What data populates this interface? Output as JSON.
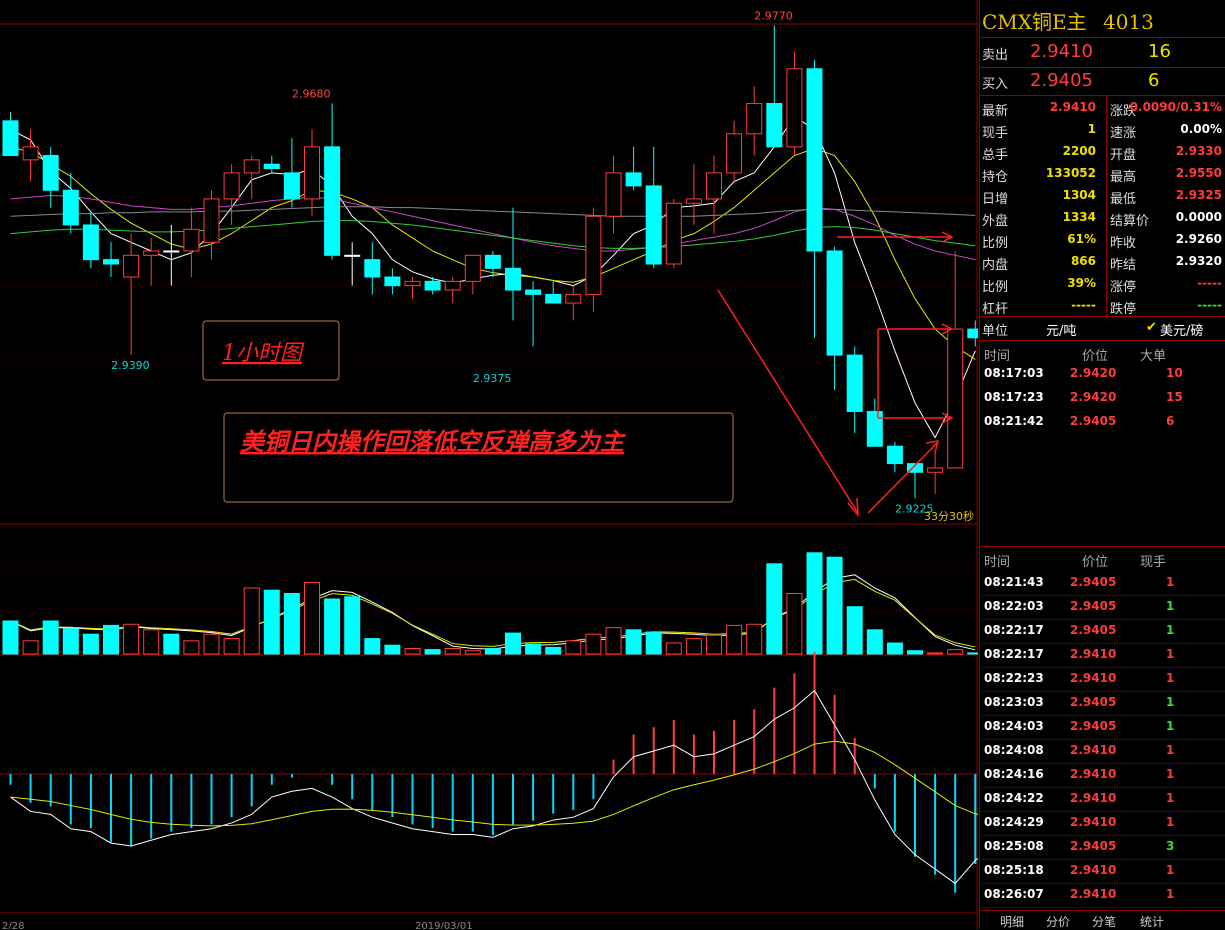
{
  "instrument": {
    "name": "CMX铜E主",
    "code": "4013"
  },
  "quote": {
    "sell_label": "卖出",
    "sell_price": "2.9410",
    "sell_vol": "16",
    "buy_label": "买入",
    "buy_price": "2.9405",
    "buy_vol": "6"
  },
  "stats": [
    {
      "l1": "最新",
      "v1": "2.9410",
      "c1": "red",
      "l2": "涨跌",
      "v2": "0.0090/0.31%",
      "c2": "red"
    },
    {
      "l1": "现手",
      "v1": "1",
      "c1": "yellow",
      "l2": "速涨",
      "v2": "0.00%",
      "c2": "white"
    },
    {
      "l1": "总手",
      "v1": "2200",
      "c1": "yellow",
      "l2": "开盘",
      "v2": "2.9330",
      "c2": "red"
    },
    {
      "l1": "持仓",
      "v1": "133052",
      "c1": "yellow",
      "l2": "最高",
      "v2": "2.9550",
      "c2": "red"
    },
    {
      "l1": "日增",
      "v1": "1304",
      "c1": "yellow",
      "l2": "最低",
      "v2": "2.9325",
      "c2": "red"
    },
    {
      "l1": "外盘",
      "v1": "1334",
      "c1": "yellow",
      "l2": "结算价",
      "v2": "0.0000",
      "c2": "white"
    },
    {
      "l1": "比例",
      "v1": "61%",
      "c1": "yellow",
      "l2": "昨收",
      "v2": "2.9260",
      "c2": "white"
    },
    {
      "l1": "内盘",
      "v1": "866",
      "c1": "yellow",
      "l2": "昨结",
      "v2": "2.9320",
      "c2": "white"
    },
    {
      "l1": "比例",
      "v1": "39%",
      "c1": "yellow",
      "l2": "涨停",
      "v2": "-----",
      "c2": "red"
    },
    {
      "l1": "杠杆",
      "v1": "-----",
      "c1": "yellow",
      "l2": "跌停",
      "v2": "-----",
      "c2": "green"
    }
  ],
  "unit": {
    "label": "单位",
    "value": "元/吨",
    "alt": "美元/磅"
  },
  "big_orders": {
    "headers": [
      "时间",
      "价位",
      "大单"
    ],
    "rows": [
      {
        "time": "08:17:03",
        "price": "2.9420",
        "vol": "10"
      },
      {
        "time": "08:17:23",
        "price": "2.9420",
        "vol": "15"
      },
      {
        "time": "08:21:42",
        "price": "2.9405",
        "vol": "6"
      }
    ]
  },
  "ticks": {
    "headers": [
      "时间",
      "价位",
      "现手"
    ],
    "rows": [
      {
        "time": "08:21:43",
        "price": "2.9405",
        "vol": "1",
        "vc": "red"
      },
      {
        "time": "08:22:03",
        "price": "2.9405",
        "vol": "1",
        "vc": "green"
      },
      {
        "time": "08:22:17",
        "price": "2.9405",
        "vol": "1",
        "vc": "green"
      },
      {
        "time": "08:22:17",
        "price": "2.9410",
        "vol": "1",
        "vc": "red"
      },
      {
        "time": "08:22:23",
        "price": "2.9410",
        "vol": "1",
        "vc": "red"
      },
      {
        "time": "08:23:03",
        "price": "2.9405",
        "vol": "1",
        "vc": "green"
      },
      {
        "time": "08:24:03",
        "price": "2.9405",
        "vol": "1",
        "vc": "green"
      },
      {
        "time": "08:24:08",
        "price": "2.9410",
        "vol": "1",
        "vc": "red"
      },
      {
        "time": "08:24:16",
        "price": "2.9410",
        "vol": "1",
        "vc": "red"
      },
      {
        "time": "08:24:22",
        "price": "2.9410",
        "vol": "1",
        "vc": "red"
      },
      {
        "time": "08:24:29",
        "price": "2.9410",
        "vol": "1",
        "vc": "red"
      },
      {
        "time": "08:25:08",
        "price": "2.9405",
        "vol": "3",
        "vc": "green"
      },
      {
        "time": "08:25:18",
        "price": "2.9410",
        "vol": "1",
        "vc": "red"
      },
      {
        "time": "08:26:07",
        "price": "2.9410",
        "vol": "1",
        "vc": "red"
      }
    ]
  },
  "tabs": [
    "明细",
    "分价",
    "分笔",
    "统计"
  ],
  "chart_data": {
    "type": "candlestick",
    "price_range": [
      2.92,
      2.979
    ],
    "price_labels": [
      {
        "text": "2.9770",
        "value": 2.977,
        "color": "#ff4444"
      },
      {
        "text": "2.9680",
        "value": 2.968,
        "color": "#ff4444"
      },
      {
        "text": "2.9390",
        "value": 2.939,
        "color": "#00d8d8"
      },
      {
        "text": "2.9375",
        "value": 2.9375,
        "color": "#00d8d8"
      },
      {
        "text": "2.9225",
        "value": 2.9225,
        "color": "#00d8d8"
      }
    ],
    "date_labels": [
      "2/28",
      "2019/03/01"
    ],
    "countdown": "33分30秒",
    "annotations": [
      "1小时图",
      "美铜日内操作回落低空反弹高多为主"
    ],
    "candles": [
      {
        "o": 2.966,
        "h": 2.967,
        "l": 2.962,
        "c": 2.962,
        "v": 30
      },
      {
        "o": 2.9615,
        "h": 2.965,
        "l": 2.959,
        "c": 2.963,
        "v": 12
      },
      {
        "o": 2.962,
        "h": 2.963,
        "l": 2.956,
        "c": 2.958,
        "v": 30
      },
      {
        "o": 2.958,
        "h": 2.96,
        "l": 2.953,
        "c": 2.954,
        "v": 23
      },
      {
        "o": 2.954,
        "h": 2.9555,
        "l": 2.949,
        "c": 2.95,
        "v": 18
      },
      {
        "o": 2.95,
        "h": 2.952,
        "l": 2.948,
        "c": 2.9495,
        "v": 26
      },
      {
        "o": 2.948,
        "h": 2.953,
        "l": 2.939,
        "c": 2.9505,
        "v": 27
      },
      {
        "o": 2.9505,
        "h": 2.9525,
        "l": 2.947,
        "c": 2.951,
        "v": 22
      },
      {
        "o": 2.951,
        "h": 2.954,
        "l": 2.947,
        "c": 2.951,
        "v": 18
      },
      {
        "o": 2.951,
        "h": 2.956,
        "l": 2.948,
        "c": 2.9535,
        "v": 12
      },
      {
        "o": 2.952,
        "h": 2.958,
        "l": 2.95,
        "c": 2.957,
        "v": 18
      },
      {
        "o": 2.957,
        "h": 2.961,
        "l": 2.954,
        "c": 2.96,
        "v": 14
      },
      {
        "o": 2.96,
        "h": 2.962,
        "l": 2.957,
        "c": 2.9615,
        "v": 60
      },
      {
        "o": 2.961,
        "h": 2.962,
        "l": 2.96,
        "c": 2.9605,
        "v": 58
      },
      {
        "o": 2.96,
        "h": 2.964,
        "l": 2.956,
        "c": 2.957,
        "v": 55
      },
      {
        "o": 2.957,
        "h": 2.965,
        "l": 2.955,
        "c": 2.963,
        "v": 65
      },
      {
        "o": 2.963,
        "h": 2.968,
        "l": 2.95,
        "c": 2.9505,
        "v": 50
      },
      {
        "o": 2.9505,
        "h": 2.952,
        "l": 2.947,
        "c": 2.9505,
        "v": 52
      },
      {
        "o": 2.95,
        "h": 2.952,
        "l": 2.946,
        "c": 2.948,
        "v": 14
      },
      {
        "o": 2.948,
        "h": 2.949,
        "l": 2.946,
        "c": 2.947,
        "v": 8
      },
      {
        "o": 2.947,
        "h": 2.948,
        "l": 2.9455,
        "c": 2.9475,
        "v": 5
      },
      {
        "o": 2.9475,
        "h": 2.948,
        "l": 2.946,
        "c": 2.9465,
        "v": 4
      },
      {
        "o": 2.9465,
        "h": 2.948,
        "l": 2.945,
        "c": 2.9475,
        "v": 5
      },
      {
        "o": 2.9475,
        "h": 2.9505,
        "l": 2.946,
        "c": 2.9505,
        "v": 3
      },
      {
        "o": 2.9505,
        "h": 2.951,
        "l": 2.948,
        "c": 2.949,
        "v": 5
      },
      {
        "o": 2.949,
        "h": 2.956,
        "l": 2.943,
        "c": 2.9465,
        "v": 19
      },
      {
        "o": 2.9465,
        "h": 2.9475,
        "l": 2.94,
        "c": 2.946,
        "v": 9
      },
      {
        "o": 2.946,
        "h": 2.9475,
        "l": 2.945,
        "c": 2.945,
        "v": 6
      },
      {
        "o": 2.945,
        "h": 2.947,
        "l": 2.943,
        "c": 2.946,
        "v": 12
      },
      {
        "o": 2.946,
        "h": 2.956,
        "l": 2.944,
        "c": 2.955,
        "v": 18
      },
      {
        "o": 2.955,
        "h": 2.962,
        "l": 2.953,
        "c": 2.96,
        "v": 24
      },
      {
        "o": 2.96,
        "h": 2.963,
        "l": 2.958,
        "c": 2.9585,
        "v": 22
      },
      {
        "o": 2.9585,
        "h": 2.963,
        "l": 2.949,
        "c": 2.9495,
        "v": 20
      },
      {
        "o": 2.9495,
        "h": 2.957,
        "l": 2.949,
        "c": 2.9565,
        "v": 10
      },
      {
        "o": 2.9565,
        "h": 2.961,
        "l": 2.954,
        "c": 2.957,
        "v": 14
      },
      {
        "o": 2.957,
        "h": 2.962,
        "l": 2.953,
        "c": 2.96,
        "v": 17
      },
      {
        "o": 2.96,
        "h": 2.966,
        "l": 2.959,
        "c": 2.9645,
        "v": 26
      },
      {
        "o": 2.9645,
        "h": 2.97,
        "l": 2.962,
        "c": 2.968,
        "v": 27
      },
      {
        "o": 2.968,
        "h": 2.977,
        "l": 2.965,
        "c": 2.963,
        "v": 82
      },
      {
        "o": 2.963,
        "h": 2.974,
        "l": 2.962,
        "c": 2.972,
        "v": 55
      },
      {
        "o": 2.972,
        "h": 2.973,
        "l": 2.941,
        "c": 2.951,
        "v": 92
      },
      {
        "o": 2.951,
        "h": 2.9515,
        "l": 2.935,
        "c": 2.939,
        "v": 88
      },
      {
        "o": 2.939,
        "h": 2.94,
        "l": 2.93,
        "c": 2.9325,
        "v": 43
      },
      {
        "o": 2.9325,
        "h": 2.934,
        "l": 2.9285,
        "c": 2.9285,
        "v": 22
      },
      {
        "o": 2.9285,
        "h": 2.929,
        "l": 2.9255,
        "c": 2.9265,
        "v": 10
      },
      {
        "o": 2.9265,
        "h": 2.9265,
        "l": 2.9225,
        "c": 2.9255,
        "v": 3
      },
      {
        "o": 2.9255,
        "h": 2.928,
        "l": 2.923,
        "c": 2.926,
        "v": 1
      },
      {
        "o": 2.926,
        "h": 2.951,
        "l": 2.926,
        "c": 2.942,
        "v": 4
      },
      {
        "o": 2.942,
        "h": 2.943,
        "l": 2.94,
        "c": 2.941,
        "v": 1
      }
    ],
    "ma": [
      {
        "color": "#ffffff",
        "values": [
          2.965,
          2.9638,
          2.9602,
          2.9582,
          2.9555,
          2.953,
          2.952,
          2.951,
          2.95,
          2.9508,
          2.953,
          2.956,
          2.9592,
          2.96,
          2.9598,
          2.9604,
          2.9585,
          2.955,
          2.953,
          2.95,
          2.9486,
          2.9478,
          2.9473,
          2.9478,
          2.9482,
          2.9484,
          2.948,
          2.9476,
          2.947,
          2.9482,
          2.9505,
          2.953,
          2.954,
          2.956,
          2.9562,
          2.9565,
          2.959,
          2.96,
          2.963,
          2.9665,
          2.965,
          2.96,
          2.952,
          2.946,
          2.9395,
          2.9335,
          2.9295,
          2.934,
          2.9395
        ]
      },
      {
        "color": "#e8e800",
        "values": [
          2.963,
          2.9624,
          2.961,
          2.9596,
          2.9576,
          2.9558,
          2.9542,
          2.953,
          2.9518,
          2.9512,
          2.9518,
          2.953,
          2.9545,
          2.956,
          2.9568,
          2.958,
          2.9578,
          2.957,
          2.956,
          2.954,
          2.9525,
          2.951,
          2.95,
          2.949,
          2.9485,
          2.9482,
          2.948,
          2.9476,
          2.9474,
          2.948,
          2.949,
          2.95,
          2.951,
          2.9522,
          2.953,
          2.9544,
          2.956,
          2.958,
          2.96,
          2.962,
          2.9628,
          2.962,
          2.959,
          2.955,
          2.95,
          2.9455,
          2.942,
          2.94,
          2.9385
        ]
      },
      {
        "color": "#cc44cc",
        "values": [
          2.957,
          2.9572,
          2.9574,
          2.9573,
          2.957,
          2.9566,
          2.9562,
          2.956,
          2.9558,
          2.9558,
          2.956,
          2.9562,
          2.9565,
          2.9568,
          2.957,
          2.9572,
          2.957,
          2.9565,
          2.956,
          2.9555,
          2.955,
          2.9545,
          2.954,
          2.9535,
          2.953,
          2.9525,
          2.952,
          2.9516,
          2.9513,
          2.951,
          2.951,
          2.9512,
          2.9514,
          2.9518,
          2.9522,
          2.9526,
          2.953,
          2.9536,
          2.9545,
          2.9555,
          2.956,
          2.9558,
          2.955,
          2.954,
          2.9528,
          2.9518,
          2.951,
          2.9505,
          2.95
        ]
      },
      {
        "color": "#33cc33",
        "values": [
          2.953,
          2.9532,
          2.9534,
          2.9535,
          2.9535,
          2.9534,
          2.9533,
          2.9532,
          2.9532,
          2.9533,
          2.9534,
          2.9536,
          2.9538,
          2.954,
          2.9542,
          2.9544,
          2.9545,
          2.9545,
          2.9544,
          2.9542,
          2.954,
          2.9537,
          2.9534,
          2.9531,
          2.9528,
          2.9525,
          2.9522,
          2.9519,
          2.9516,
          2.9514,
          2.9513,
          2.9513,
          2.9514,
          2.9515,
          2.9517,
          2.9519,
          2.9521,
          2.9524,
          2.9528,
          2.9533,
          2.9537,
          2.9538,
          2.9537,
          2.9534,
          2.953,
          2.9526,
          2.9522,
          2.9519,
          2.9516
        ]
      },
      {
        "color": "#888888",
        "values": [
          2.955,
          2.9551,
          2.9552,
          2.9553,
          2.9553,
          2.9554,
          2.9554,
          2.9555,
          2.9555,
          2.9555,
          2.9556,
          2.9556,
          2.9557,
          2.9558,
          2.9559,
          2.956,
          2.9561,
          2.9561,
          2.9561,
          2.956,
          2.956,
          2.9559,
          2.9558,
          2.9557,
          2.9556,
          2.9555,
          2.9554,
          2.9553,
          2.9552,
          2.9551,
          2.955,
          2.955,
          2.955,
          2.955,
          2.955,
          2.9551,
          2.9552,
          2.9553,
          2.9555,
          2.9557,
          2.9558,
          2.9558,
          2.9557,
          2.9556,
          2.9555,
          2.9554,
          2.9553,
          2.9552,
          2.9551
        ]
      }
    ],
    "macd": [
      -3,
      -8,
      -9,
      -14,
      -15,
      -19,
      -20,
      -18,
      -16,
      -15,
      -14,
      -12,
      -9,
      -3,
      -1,
      0,
      -3,
      -7,
      -10,
      -12,
      -14,
      -15,
      -16,
      -16,
      -17,
      -14,
      -13,
      -11,
      -10,
      -7,
      4,
      11,
      13,
      15,
      11,
      12,
      15,
      18,
      24,
      28,
      34,
      22,
      10,
      -4,
      -16,
      -23,
      -28,
      -33,
      -25,
      -20
    ]
  }
}
